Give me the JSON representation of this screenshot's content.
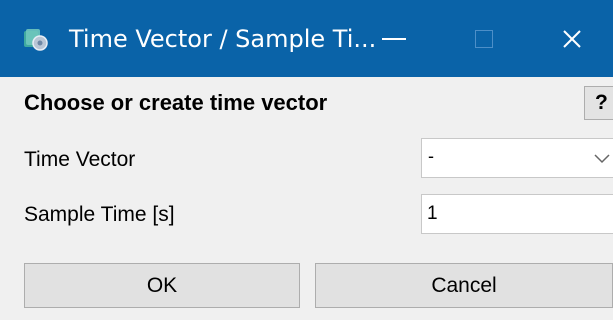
{
  "window": {
    "title": "Time Vector / Sample Ti...",
    "title_bar_color": "#0a63a8",
    "icon": "app-gear-icon",
    "controls": [
      "minimize-icon",
      "maximize-icon",
      "close-icon"
    ],
    "close_glyph": "✕"
  },
  "header": {
    "label": "Choose or create time vector",
    "help_label": "?"
  },
  "fields": {
    "time_vector": {
      "label": "Time Vector",
      "selected": "-"
    },
    "sample_time": {
      "label": "Sample Time [s]",
      "value": "1"
    }
  },
  "buttons": {
    "ok": "OK",
    "cancel": "Cancel"
  }
}
